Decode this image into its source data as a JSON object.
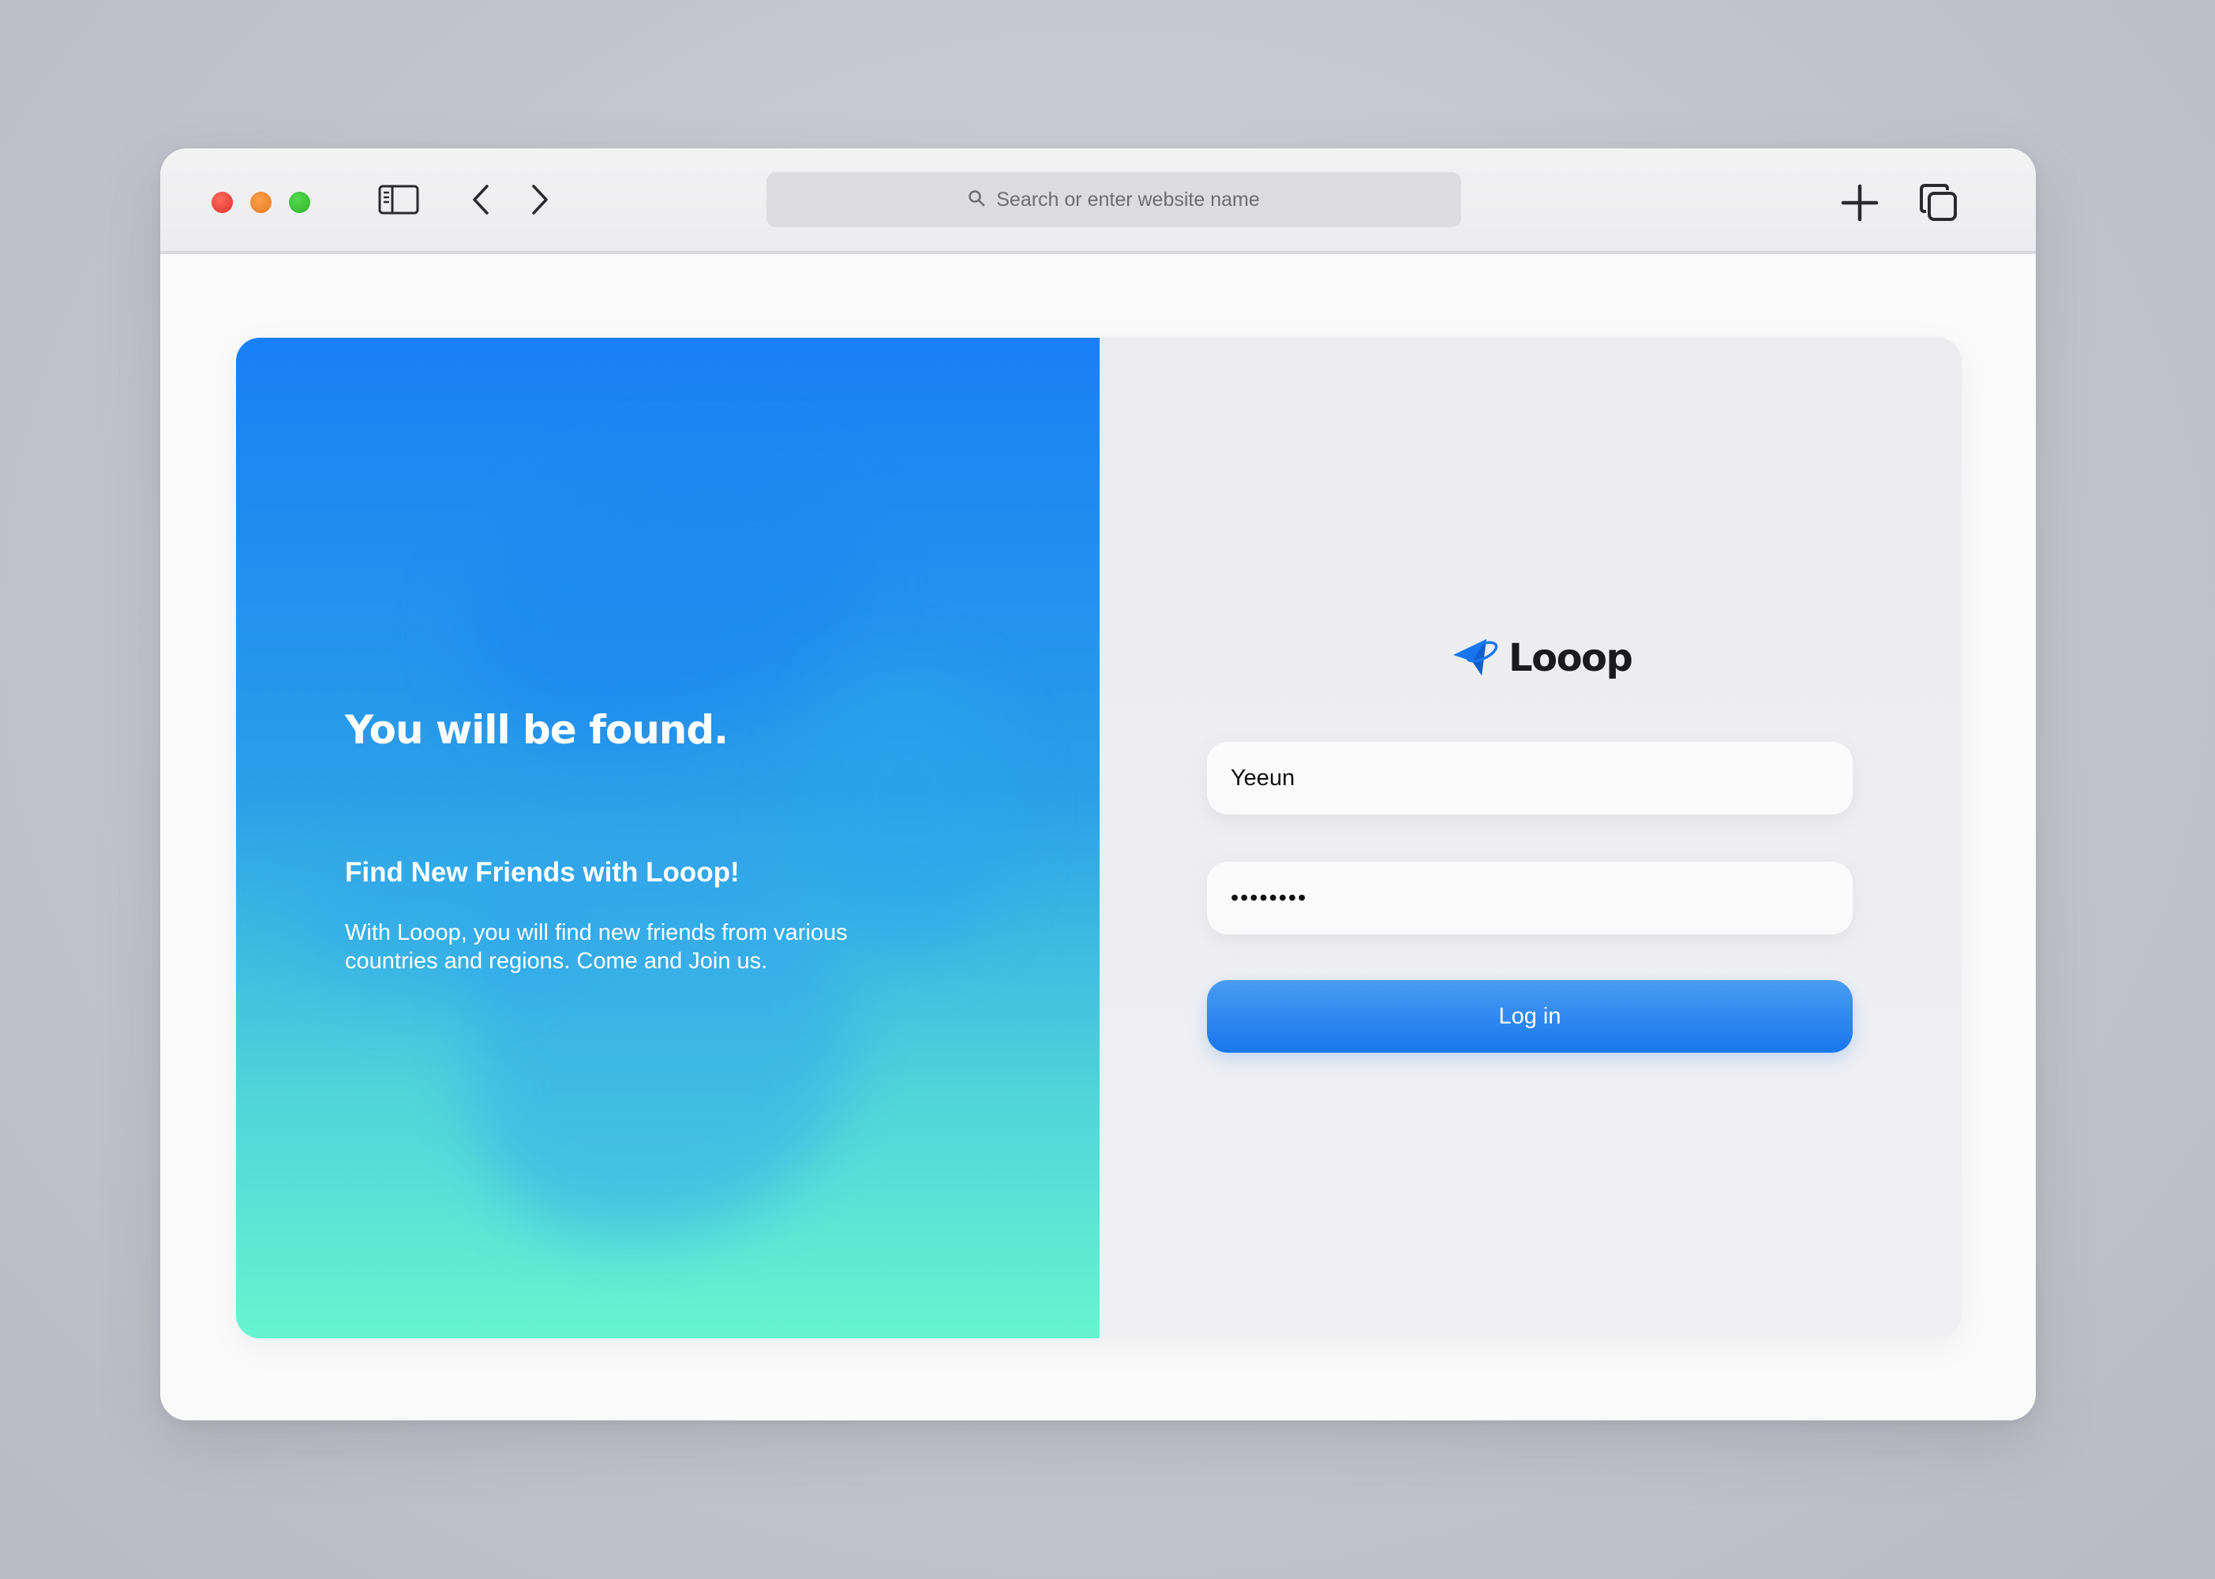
{
  "browser": {
    "address_placeholder": "Search or enter website name"
  },
  "hero": {
    "title": "You will be found.",
    "subtitle": "Find New Friends with Looop!",
    "body": "With Looop, you will find new friends from various countries and regions. Come and Join us."
  },
  "login": {
    "brand_name": "Looop",
    "username_value": "Yeeun",
    "password_value": "12345678",
    "login_button_label": "Log in"
  },
  "colors": {
    "accent": "#1877ee",
    "hero_top": "#1a7ff6",
    "hero_bottom": "#66f5cf"
  },
  "icons": {
    "sidebar": "sidebar-icon",
    "back": "chevron-left-icon",
    "forward": "chevron-right-icon",
    "search": "search-icon",
    "new_tab": "plus-icon",
    "tabs": "tabs-overview-icon",
    "logo": "looop-logo-icon"
  }
}
